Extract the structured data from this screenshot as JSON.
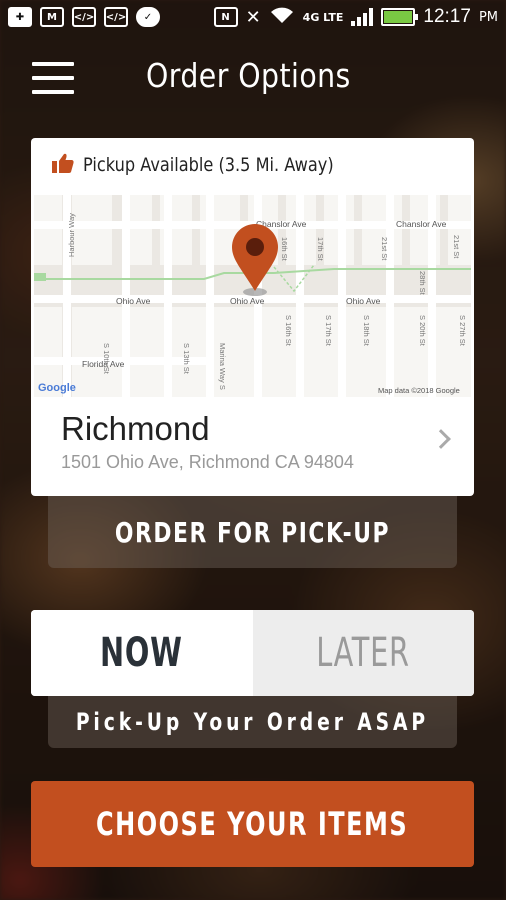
{
  "status_bar": {
    "icons": [
      "plus-icon",
      "gmail-icon",
      "code-icon",
      "code-icon",
      "messenger-icon",
      "nfc-icon",
      "mute-icon",
      "wifi-icon",
      "lte-icon",
      "signal-icon",
      "battery-icon"
    ],
    "network": "4G LTE",
    "time": "12:17",
    "ampm": "PM"
  },
  "header": {
    "title": "Order Options",
    "menu_icon": "hamburger-menu-icon"
  },
  "location_card": {
    "pickup_label": "Pickup Available (3.5 Mi. Away)",
    "pickup_icon": "thumbs-up-icon",
    "location_name": "Richmond",
    "address": "1501 Ohio Ave, Richmond CA 94804",
    "map": {
      "streets": [
        "Harbour Way",
        "Chanslor Ave",
        "Ohio Ave",
        "Ohio Ave",
        "Ohio Ave",
        "Florida Ave",
        "Marina Way S",
        "S 10th St",
        "S 13th St",
        "S 14th St",
        "S 16th St",
        "S 17th St",
        "S 18th St",
        "S 19th St",
        "S 20th St",
        "S 21st St",
        "S 23rd St",
        "21st St",
        "28th St",
        "S 27th St"
      ],
      "logo": "Google",
      "attribution": "Map data ©2018 Google"
    }
  },
  "order_pickup_label": "ORDER FOR PICK-UP",
  "time_toggle": {
    "now_label": "NOW",
    "later_label": "LATER",
    "selected": "NOW"
  },
  "asap_label": "Pick-Up Your Order ASAP",
  "choose_items_label": "CHOOSE YOUR ITEMS",
  "colors": {
    "accent": "#c24f1f",
    "pin": "#c24f1f",
    "pickup_icon": "#c24f1f"
  }
}
